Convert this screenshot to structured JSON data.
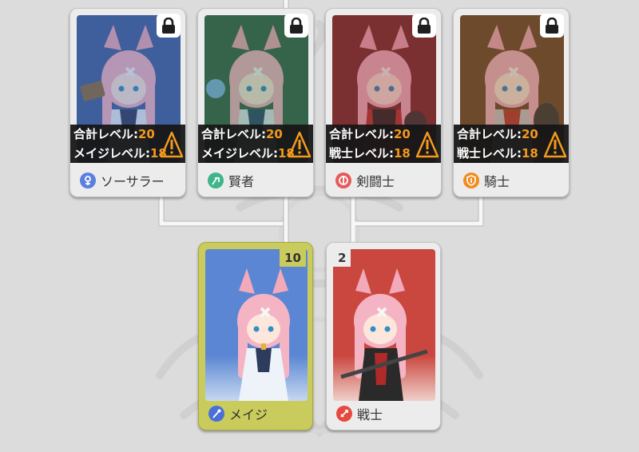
{
  "colors": {
    "background": "#dcdcdc",
    "card": "#ececec",
    "selected_card": "#c9cc5c",
    "level_number": "#f39a1e",
    "stats_bar": "#161616",
    "connector": "#f7f7f7"
  },
  "advanced_jobs": [
    {
      "name": "ソーサラー",
      "locked": true,
      "portrait_bg": "#3f5f9c",
      "job_icon": "sorcerer-icon",
      "icon_color": "#5a7fe0",
      "total_level_label": "合計レベル:",
      "total_level": "20",
      "base_level_label": "メイジレベル:",
      "base_level": "18"
    },
    {
      "name": "賢者",
      "locked": true,
      "portrait_bg": "#36644a",
      "job_icon": "sage-icon",
      "icon_color": "#3fb58a",
      "total_level_label": "合計レベル:",
      "total_level": "20",
      "base_level_label": "メイジレベル:",
      "base_level": "18"
    },
    {
      "name": "剣闘士",
      "locked": true,
      "portrait_bg": "#7a2f30",
      "job_icon": "gladiator-icon",
      "icon_color": "#e65a5a",
      "total_level_label": "合計レベル:",
      "total_level": "20",
      "base_level_label": "戦士レベル:",
      "base_level": "18"
    },
    {
      "name": "騎士",
      "locked": true,
      "portrait_bg": "#6e4a2c",
      "job_icon": "knight-icon",
      "icon_color": "#f08c1e",
      "total_level_label": "合計レベル:",
      "total_level": "20",
      "base_level_label": "戦士レベル:",
      "base_level": "18"
    }
  ],
  "base_jobs": [
    {
      "name": "メイジ",
      "level": "10",
      "selected": true,
      "portrait_bg": "#5b86d3",
      "job_icon": "mage-staff-icon",
      "icon_color": "#4a6fd8"
    },
    {
      "name": "戦士",
      "level": "2",
      "selected": false,
      "portrait_bg": "#c9473e",
      "job_icon": "warrior-sword-icon",
      "icon_color": "#e8493f"
    }
  ]
}
